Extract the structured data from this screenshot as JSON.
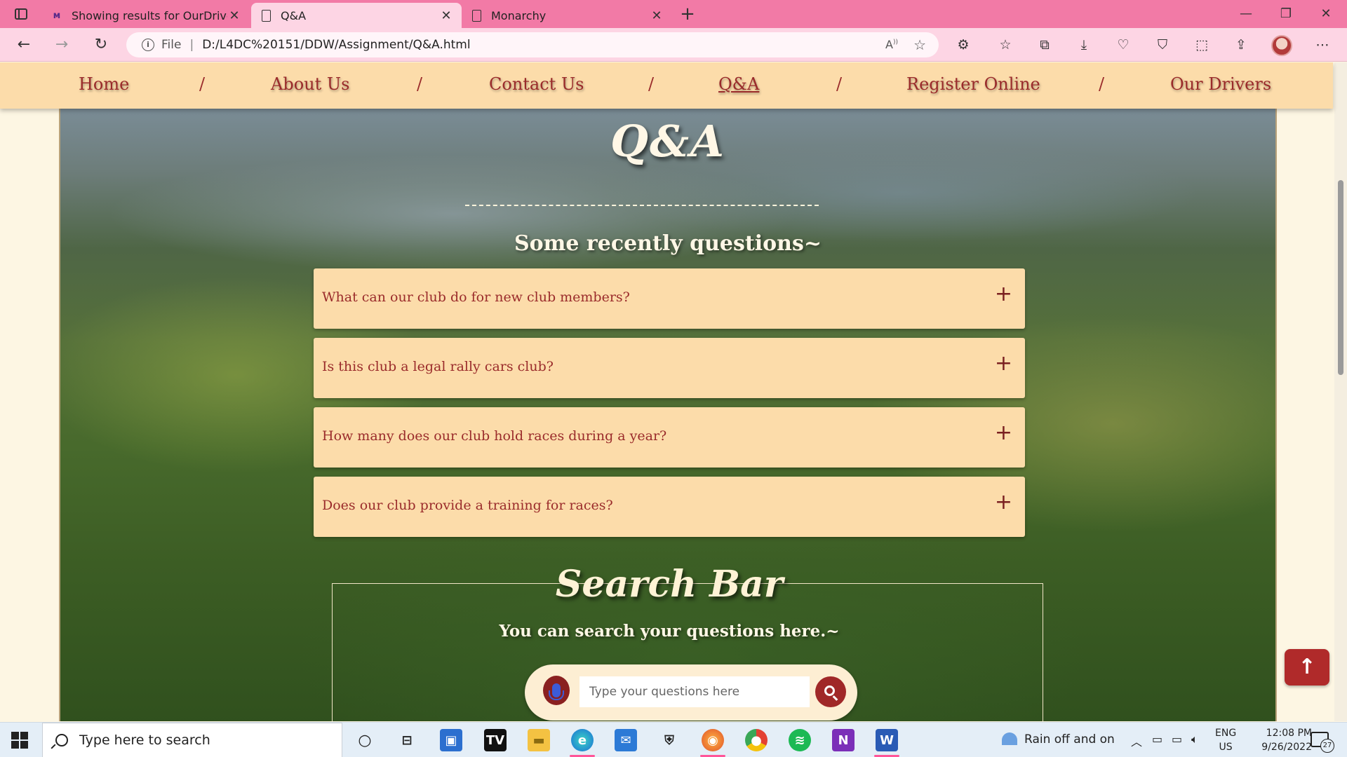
{
  "browser": {
    "tabs": [
      {
        "title": "Showing results for OurDrivers.h",
        "icon": "site-favicon",
        "active": false
      },
      {
        "title": "Q&A",
        "icon": "page-icon",
        "active": true
      },
      {
        "title": "Monarchy",
        "icon": "page-icon",
        "active": false
      }
    ],
    "url_scheme": "File",
    "url": "D:/L4DC%20151/DDW/Assignment/Q&A.html",
    "read_aloud": "A̓",
    "accent_color": "#f27aa6"
  },
  "site_nav": {
    "items": [
      {
        "label": "Home",
        "current": false
      },
      {
        "label": "About Us",
        "current": false
      },
      {
        "label": "Contact Us",
        "current": false
      },
      {
        "label": "Q&A",
        "current": true
      },
      {
        "label": "Register Online",
        "current": false
      },
      {
        "label": "Our Drivers",
        "current": false
      }
    ],
    "separator": "/",
    "color": "#9a2b2b",
    "background": "#fcdcaa"
  },
  "hero": {
    "title": "Q&A",
    "subtitle": "Some recently questions~"
  },
  "faq": [
    {
      "question": "What can our club do for new club members?",
      "toggle": "+"
    },
    {
      "question": "Is this club a legal rally cars club?",
      "toggle": "+"
    },
    {
      "question": "How many does our club hold races during a year?",
      "toggle": "+"
    },
    {
      "question": "Does our club provide a training for races?",
      "toggle": "+"
    }
  ],
  "search_section": {
    "title": "Search Bar",
    "subtitle": "You can search your questions here.~",
    "placeholder": "Type your questions here",
    "mic_icon": "microphone-icon",
    "search_icon": "search-icon"
  },
  "back_to_top": {
    "icon": "arrow-up-icon",
    "glyph": "↑"
  },
  "taskbar": {
    "search_placeholder": "Type here to search",
    "apps": [
      "cortana",
      "task-view",
      "store",
      "tradingview",
      "file-explorer",
      "edge",
      "mail",
      "security",
      "firefox",
      "chrome",
      "spotify",
      "onenote",
      "word"
    ],
    "weather": "Rain off and on",
    "lang_top": "ENG",
    "lang_bottom": "US",
    "time": "12:08 PM",
    "date": "9/26/2022",
    "notifications": "27"
  }
}
